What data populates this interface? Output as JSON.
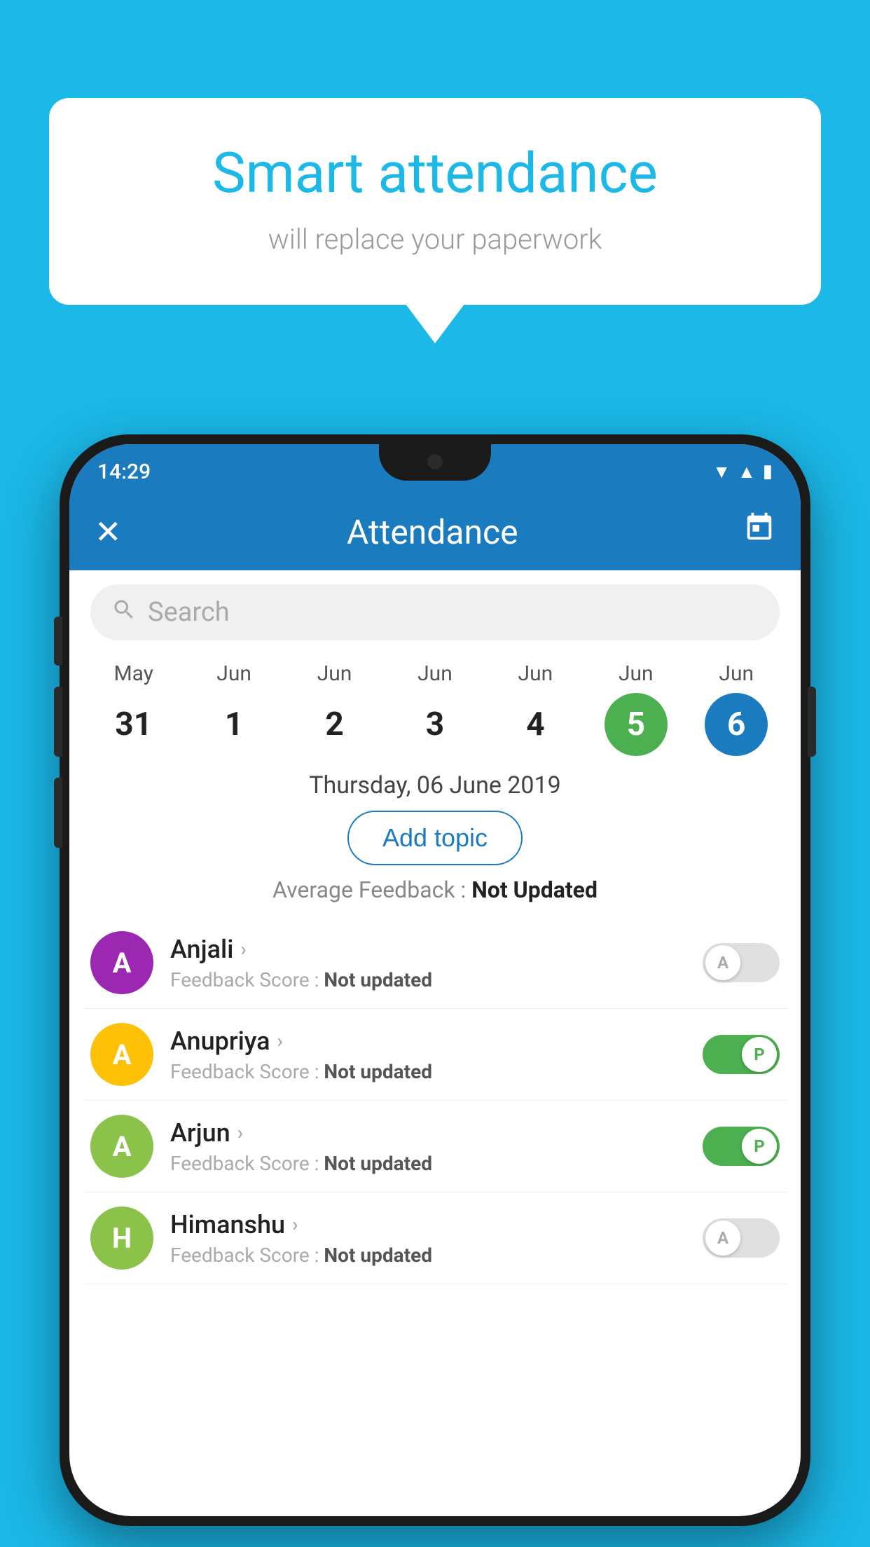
{
  "page": {
    "background_color": "#1bb8e8"
  },
  "speech_bubble": {
    "title": "Smart attendance",
    "subtitle": "will replace your paperwork"
  },
  "status_bar": {
    "time": "14:29",
    "wifi_icon": "▾",
    "signal_icon": "▲",
    "battery_icon": "▮"
  },
  "app_bar": {
    "title": "Attendance",
    "close_label": "✕",
    "calendar_label": "📅"
  },
  "search": {
    "placeholder": "Search"
  },
  "calendar": {
    "days": [
      {
        "month": "May",
        "date": "31",
        "state": "normal"
      },
      {
        "month": "Jun",
        "date": "1",
        "state": "normal"
      },
      {
        "month": "Jun",
        "date": "2",
        "state": "normal"
      },
      {
        "month": "Jun",
        "date": "3",
        "state": "normal"
      },
      {
        "month": "Jun",
        "date": "4",
        "state": "normal"
      },
      {
        "month": "Jun",
        "date": "5",
        "state": "today"
      },
      {
        "month": "Jun",
        "date": "6",
        "state": "selected"
      }
    ]
  },
  "selected_date": {
    "label": "Thursday, 06 June 2019"
  },
  "add_topic": {
    "label": "Add topic"
  },
  "average_feedback": {
    "prefix": "Average Feedback : ",
    "value": "Not Updated"
  },
  "students": [
    {
      "name": "Anjali",
      "initial": "A",
      "avatar_color": "#9c27b0",
      "feedback_label": "Feedback Score : ",
      "feedback_value": "Not updated",
      "attendance": "absent",
      "toggle_letter": "A"
    },
    {
      "name": "Anupriya",
      "initial": "A",
      "avatar_color": "#ffc107",
      "feedback_label": "Feedback Score : ",
      "feedback_value": "Not updated",
      "attendance": "present",
      "toggle_letter": "P"
    },
    {
      "name": "Arjun",
      "initial": "A",
      "avatar_color": "#8bc34a",
      "feedback_label": "Feedback Score : ",
      "feedback_value": "Not updated",
      "attendance": "present",
      "toggle_letter": "P"
    },
    {
      "name": "Himanshu",
      "initial": "H",
      "avatar_color": "#8bc34a",
      "feedback_label": "Feedback Score : ",
      "feedback_value": "Not updated",
      "attendance": "absent",
      "toggle_letter": "A"
    }
  ]
}
